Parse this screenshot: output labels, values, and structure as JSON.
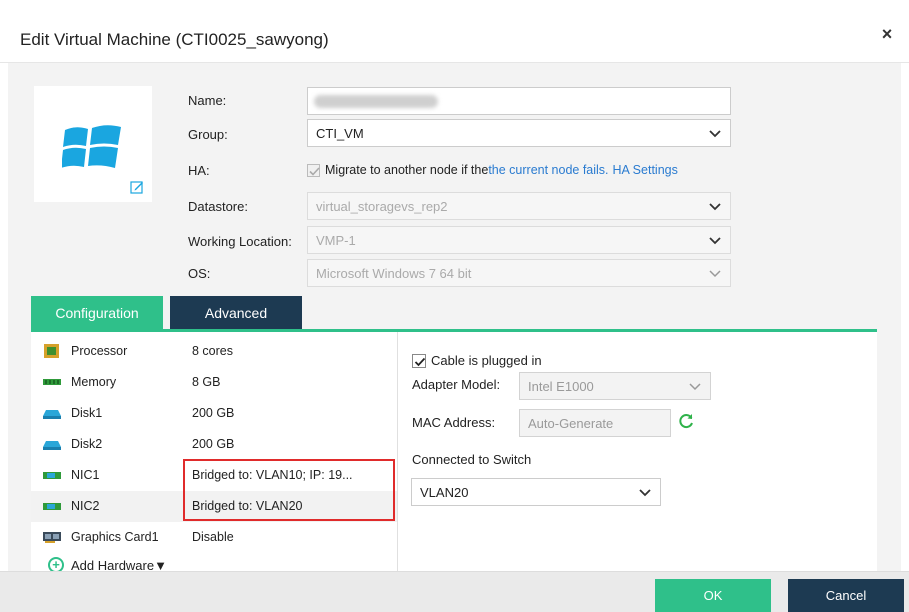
{
  "dialog": {
    "title": "Edit Virtual Machine (CTI0025_sawyong)",
    "close_label": "×"
  },
  "form": {
    "name_label": "Name:",
    "name_value": "",
    "group_label": "Group:",
    "group_value": "CTI_VM",
    "ha_label": "HA:",
    "ha_text_prefix": "Migrate to another node if the ",
    "ha_text_link": "the current node fails.",
    "ha_settings_link": "HA Settings",
    "ha_checked": true,
    "datastore_label": "Datastore:",
    "datastore_value": "virtual_storagevs_rep2",
    "location_label": "Working Location:",
    "location_value": "VMP-1",
    "os_label": "OS:",
    "os_value": "Microsoft Windows 7 64 bit"
  },
  "tabs": {
    "configuration": "Configuration",
    "advanced": "Advanced"
  },
  "hardware": [
    {
      "name": "Processor",
      "value": "8 cores",
      "icon": "cpu-icon"
    },
    {
      "name": "Memory",
      "value": "8 GB",
      "icon": "memory-icon"
    },
    {
      "name": "Disk1",
      "value": "200 GB",
      "icon": "disk-icon"
    },
    {
      "name": "Disk2",
      "value": "200 GB",
      "icon": "disk-icon"
    },
    {
      "name": "NIC1",
      "value": "Bridged to: VLAN10; IP:  19...",
      "icon": "nic-icon"
    },
    {
      "name": "NIC2",
      "value": "Bridged to: VLAN20",
      "icon": "nic-icon"
    },
    {
      "name": "Graphics Card1",
      "value": "Disable",
      "icon": "graphics-card-icon"
    }
  ],
  "add_hardware_label": "Add Hardware▼",
  "nic_panel": {
    "cable_label": "Cable is plugged in",
    "cable_checked": true,
    "adapter_label": "Adapter Model:",
    "adapter_value": "Intel E1000",
    "mac_label": "MAC Address:",
    "mac_value": "Auto-Generate",
    "switch_label": "Connected to Switch",
    "switch_value": "VLAN20"
  },
  "footer": {
    "ok_label": "OK",
    "cancel_label": "Cancel"
  },
  "colors": {
    "accent": "#2fc08a",
    "dark": "#1d3a52",
    "link": "#2a7bd0",
    "highlight": "#e02b2b"
  }
}
